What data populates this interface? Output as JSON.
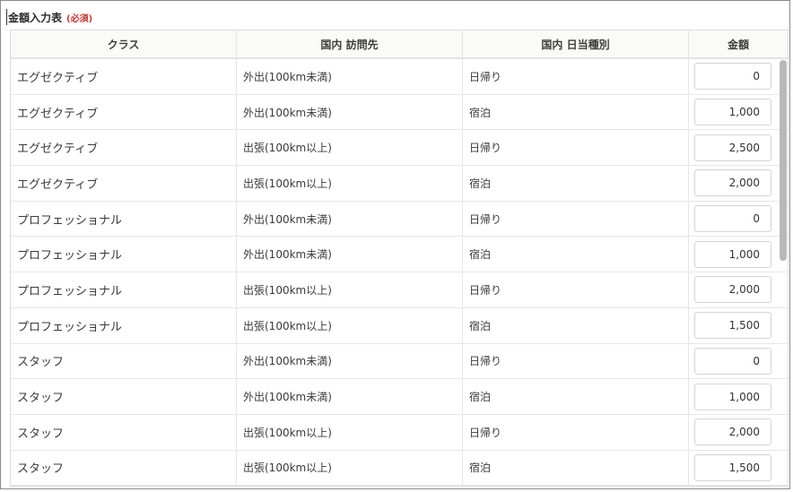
{
  "section": {
    "title": "金額入力表",
    "required": "(必須)"
  },
  "table": {
    "headers": [
      "クラス",
      "国内 訪問先",
      "国内 日当種別",
      "金額"
    ],
    "rows": [
      {
        "class": "エグゼクティブ",
        "destination": "外出(100km未満)",
        "type": "日帰り",
        "amount": "0"
      },
      {
        "class": "エグゼクティブ",
        "destination": "外出(100km未満)",
        "type": "宿泊",
        "amount": "1,000"
      },
      {
        "class": "エグゼクティブ",
        "destination": "出張(100km以上)",
        "type": "日帰り",
        "amount": "2,500"
      },
      {
        "class": "エグゼクティブ",
        "destination": "出張(100km以上)",
        "type": "宿泊",
        "amount": "2,000"
      },
      {
        "class": "プロフェッショナル",
        "destination": "外出(100km未満)",
        "type": "日帰り",
        "amount": "0"
      },
      {
        "class": "プロフェッショナル",
        "destination": "外出(100km未満)",
        "type": "宿泊",
        "amount": "1,000"
      },
      {
        "class": "プロフェッショナル",
        "destination": "出張(100km以上)",
        "type": "日帰り",
        "amount": "2,000"
      },
      {
        "class": "プロフェッショナル",
        "destination": "出張(100km以上)",
        "type": "宿泊",
        "amount": "1,500"
      },
      {
        "class": "スタッフ",
        "destination": "外出(100km未満)",
        "type": "日帰り",
        "amount": "0"
      },
      {
        "class": "スタッフ",
        "destination": "外出(100km未満)",
        "type": "宿泊",
        "amount": "1,000"
      },
      {
        "class": "スタッフ",
        "destination": "出張(100km以上)",
        "type": "日帰り",
        "amount": "2,000"
      },
      {
        "class": "スタッフ",
        "destination": "出張(100km以上)",
        "type": "宿泊",
        "amount": "1,500"
      }
    ]
  }
}
